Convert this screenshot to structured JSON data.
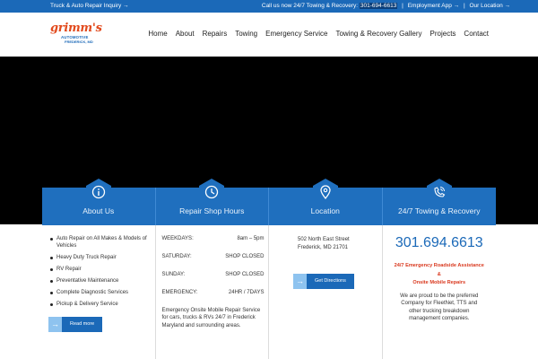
{
  "topbar": {
    "inquiry": "Truck & Auto Repair Inquiry →",
    "call_prefix": "Call us now 24/7 Towing & Recovery:",
    "phone": "301-694-6613",
    "employment": "Employment App →",
    "sep": "|",
    "location": "Our Location →"
  },
  "logo": {
    "script": "grimm's",
    "line1": "AUTOMOTIVE",
    "line2": "FREDERICK, MD"
  },
  "nav": [
    "Home",
    "About",
    "Repairs",
    "Towing",
    "Emergency Service",
    "Towing & Recovery Gallery",
    "Projects",
    "Contact"
  ],
  "panels": [
    {
      "label": "About Us",
      "icon": "info-icon"
    },
    {
      "label": "Repair Shop Hours",
      "icon": "clock-icon"
    },
    {
      "label": "Location",
      "icon": "map-pin-icon"
    },
    {
      "label": "24/7 Towing & Recovery",
      "icon": "phone-call-icon"
    }
  ],
  "about": {
    "items": [
      "Auto Repair on All Makes & Models of Vehicles",
      "Heavy Duty Truck Repair",
      "RV Repair",
      "Preventative Maintenance",
      "Complete Diagnostic Services",
      "Pickup & Delivery Service"
    ],
    "button": "Read more"
  },
  "hours": {
    "rows": [
      {
        "day": "WEEKDAYS:",
        "time": "8am – 5pm"
      },
      {
        "day": "SATURDAY:",
        "time": "SHOP CLOSED"
      },
      {
        "day": "SUNDAY:",
        "time": "SHOP CLOSED"
      },
      {
        "day": "EMERGENCY:",
        "time": "24HR / 7DAYS"
      }
    ],
    "note": "Emergency Onsite Mobile Repair Service for cars, trucks & RVs 24/7 in Frederick Maryland and surrounding areas."
  },
  "location": {
    "street": "502 North East Street",
    "city": "Frederick, MD 21701",
    "button": "Get Directions"
  },
  "towing": {
    "phone": "301.694.6613",
    "line1": "24/7 Emergency Roadside Assistance",
    "amp": "&",
    "line2": "Onsite Mobile Repairs",
    "desc": "We are proud to be the preferred Company for FleetNet, TTS and other trucking breakdown management companies."
  },
  "colors": {
    "brand_blue": "#1b69b8",
    "panel_blue": "#1f6fbe",
    "accent_orange": "#d9381e",
    "button_light": "#8ec3ef"
  }
}
